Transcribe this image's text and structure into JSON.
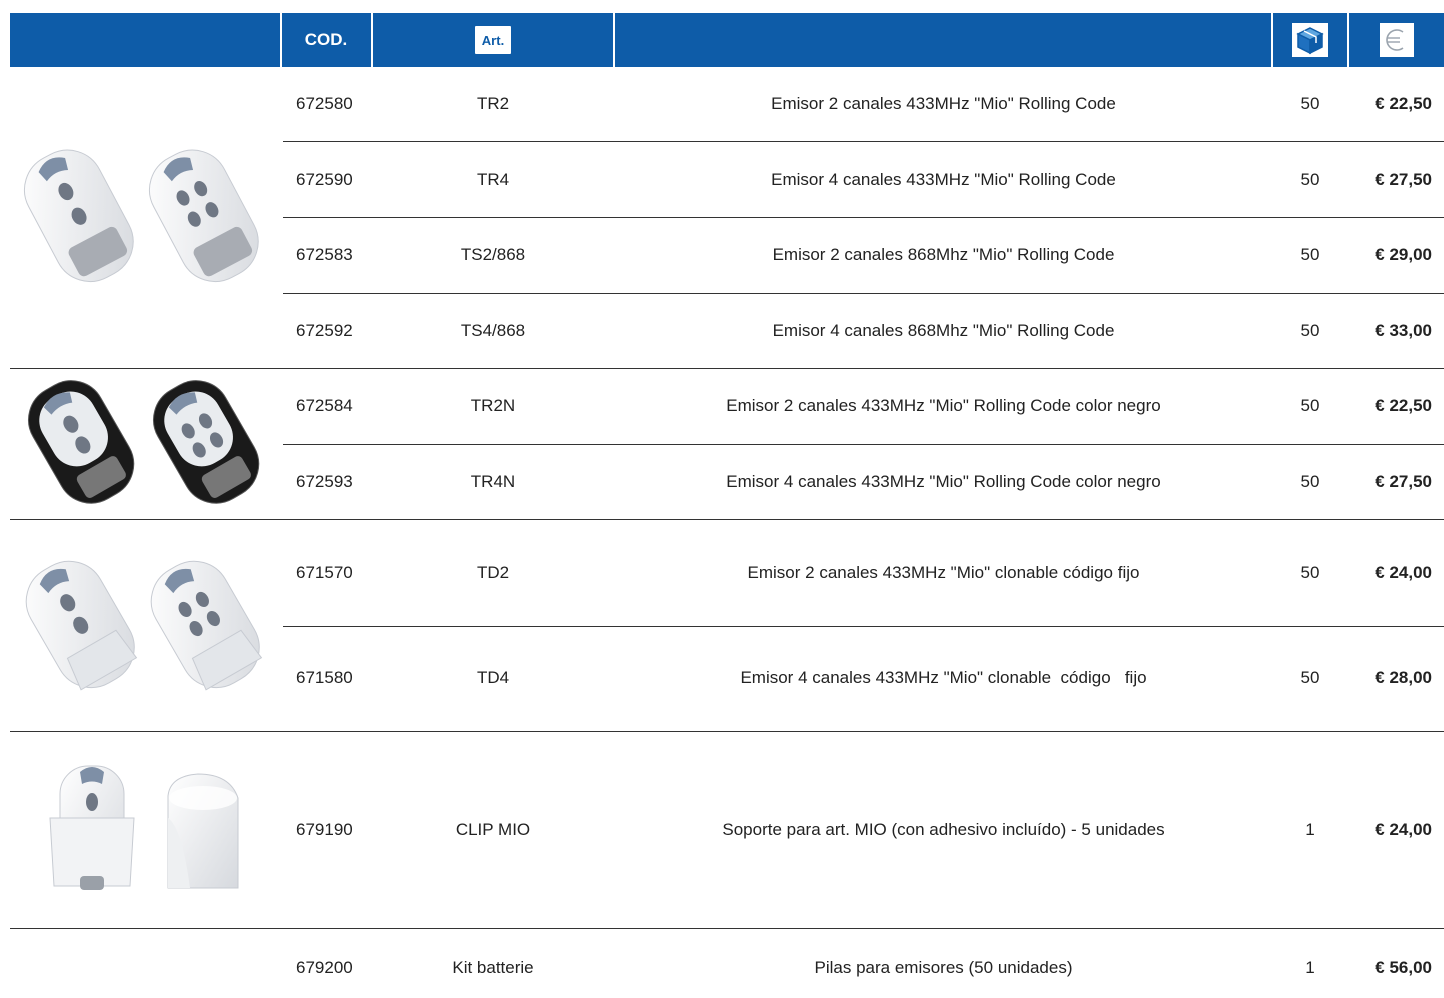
{
  "header": {
    "cod_label": "COD.",
    "art_label": "Art.",
    "box_icon": "package-box-icon",
    "euro_icon": "euro-icon"
  },
  "rows": [
    {
      "code": "672580",
      "art": "TR2",
      "desc": "Emisor 2 canales 433MHz \"Mio\" Rolling Code",
      "qty": "50",
      "price": "€ 22,50"
    },
    {
      "code": "672590",
      "art": "TR4",
      "desc": "Emisor 4 canales 433MHz \"Mio\" Rolling Code",
      "qty": "50",
      "price": "€ 27,50"
    },
    {
      "code": "672583",
      "art": "TS2/868",
      "desc": "Emisor 2 canales 868Mhz \"Mio\" Rolling Code",
      "qty": "50",
      "price": "€ 29,00"
    },
    {
      "code": "672592",
      "art": "TS4/868",
      "desc": "Emisor 4 canales 868Mhz \"Mio\" Rolling Code",
      "qty": "50",
      "price": "€ 33,00"
    },
    {
      "code": "672584",
      "art": "TR2N",
      "desc": "Emisor 2 canales 433MHz \"Mio\" Rolling Code color negro",
      "qty": "50",
      "price": "€ 22,50"
    },
    {
      "code": "672593",
      "art": "TR4N",
      "desc": "Emisor 4 canales 433MHz \"Mio\" Rolling Code color negro",
      "qty": "50",
      "price": "€ 27,50"
    },
    {
      "code": "671570",
      "art": "TD2",
      "desc": "Emisor 2 canales 433MHz \"Mio\" clonable código fijo",
      "qty": "50",
      "price": "€ 24,00"
    },
    {
      "code": "671580",
      "art": "TD4",
      "desc": "Emisor 4 canales 433MHz \"Mio\" clonable  código   fijo",
      "qty": "50",
      "price": "€ 28,00"
    },
    {
      "code": "679190",
      "art": "CLIP MIO",
      "desc": "Soporte para art. MIO (con adhesivo incluído) - 5 unidades",
      "qty": "1",
      "price": "€ 24,00"
    },
    {
      "code": "679200",
      "art": "Kit batterie",
      "desc": "Pilas para emisores (50 unidades)",
      "qty": "1",
      "price": "€ 56,00"
    }
  ],
  "images": {
    "group1": "white-remote-controls-image",
    "group2": "black-remote-controls-image",
    "group3": "clonable-remote-controls-image",
    "group4": "remote-clip-holder-image"
  }
}
